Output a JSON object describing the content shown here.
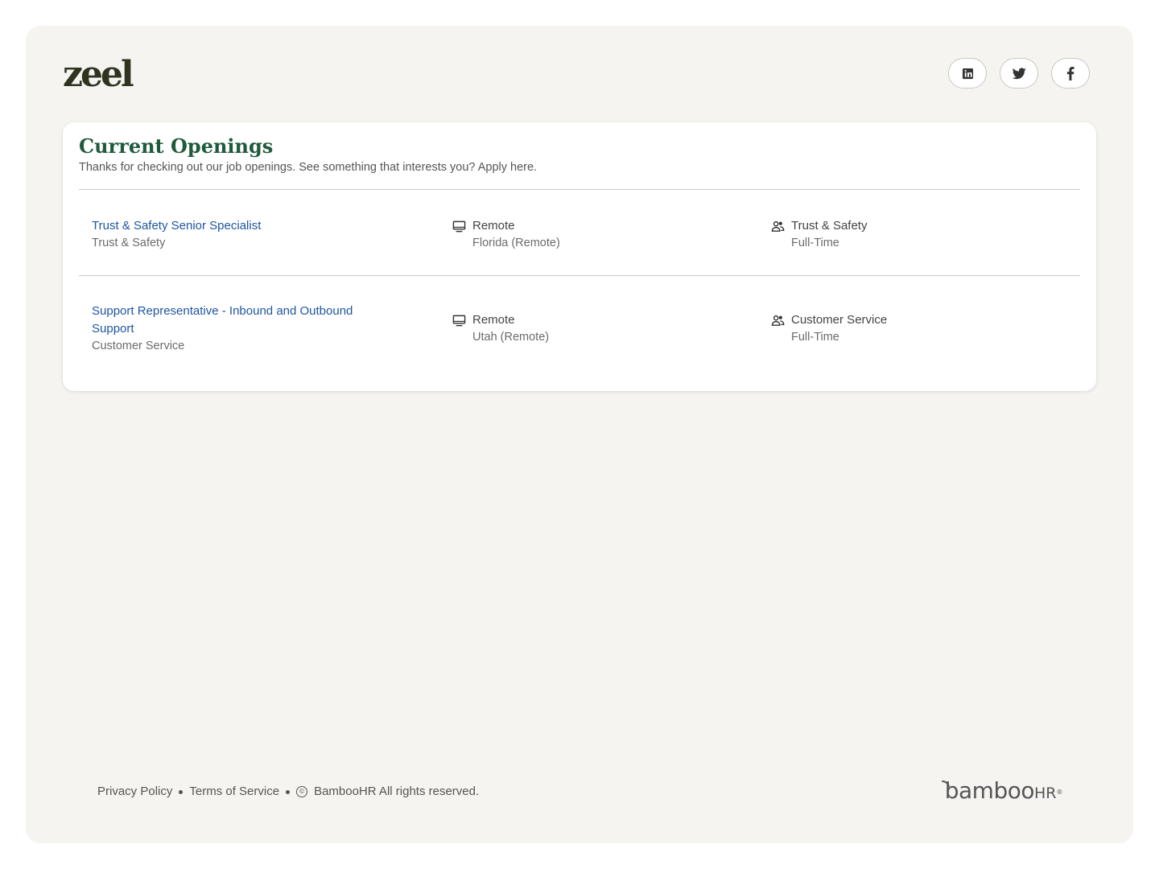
{
  "header": {
    "logo_text": "zeel",
    "social": [
      {
        "name": "linkedin",
        "icon": "linkedin-icon"
      },
      {
        "name": "twitter",
        "icon": "twitter-icon"
      },
      {
        "name": "facebook",
        "icon": "facebook-icon"
      }
    ]
  },
  "openings": {
    "title": "Current Openings",
    "subtitle": "Thanks for checking out our job openings. See something that interests you? Apply here.",
    "jobs": [
      {
        "title": "Trust & Safety Senior Specialist",
        "department": "Trust & Safety",
        "location_type": "Remote",
        "location": "Florida (Remote)",
        "team": "Trust & Safety",
        "employment_type": "Full-Time"
      },
      {
        "title": "Support Representative - Inbound and Outbound Support",
        "department": "Customer Service",
        "location_type": "Remote",
        "location": "Utah (Remote)",
        "team": "Customer Service",
        "employment_type": "Full-Time"
      }
    ]
  },
  "footer": {
    "privacy": "Privacy Policy",
    "terms": "Terms of Service",
    "copyright_symbol": "©",
    "copyright": "BambooHR All rights reserved.",
    "brand_main": "bamboo",
    "brand_hr": "HR",
    "brand_tm": "®"
  },
  "colors": {
    "background": "#f5f4f1",
    "title_green": "#1f5a3c",
    "link_blue": "#1f56a3",
    "logo": "#2f3320"
  }
}
